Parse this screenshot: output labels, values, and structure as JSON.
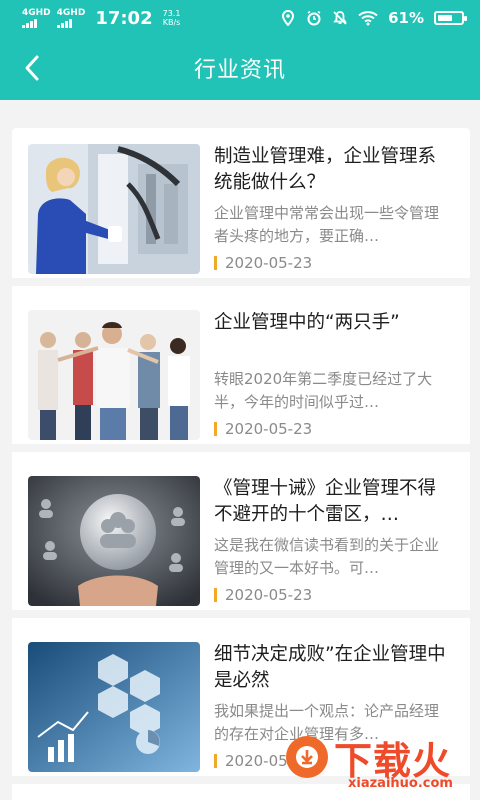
{
  "status_bar": {
    "signal_1": "4GHD",
    "signal_2": "4GHD",
    "time": "17:02",
    "speed_value": "73.1",
    "speed_unit": "KB/s",
    "battery_percent": "61%",
    "icons": [
      "location-icon",
      "alarm-icon",
      "mute-icon",
      "wifi-icon",
      "battery-icon"
    ]
  },
  "header": {
    "title": "行业资讯",
    "back_icon": "chevron-left-icon"
  },
  "articles": [
    {
      "title": "制造业管理难，企业管理系统能做什么？",
      "summary": "企业管理中常常会出现一些令管理者头疼的地方，要正确…",
      "date": "2020-05-23"
    },
    {
      "title": "企业管理中的“两只手”",
      "summary": "转眼2020年第二季度已经过了大半，今年的时间似乎过…",
      "date": "2020-05-23"
    },
    {
      "title": "《管理十诫》企业管理不得不避开的十个雷区，…",
      "summary": "这是我在微信读书看到的关于企业管理的又一本好书。可…",
      "date": "2020-05-23"
    },
    {
      "title": "细节决定成败”在企业管理中是必然",
      "summary": "我如果提出一个观点：论产品经理的存在对企业管理有多…",
      "date": "2020-05-23"
    }
  ],
  "watermark": {
    "text": "下载火",
    "sub": "xiazaihuo.com"
  },
  "colors": {
    "primary": "#20c3b6",
    "date_accent": "#f2a928",
    "watermark": "#ef4a2a"
  }
}
